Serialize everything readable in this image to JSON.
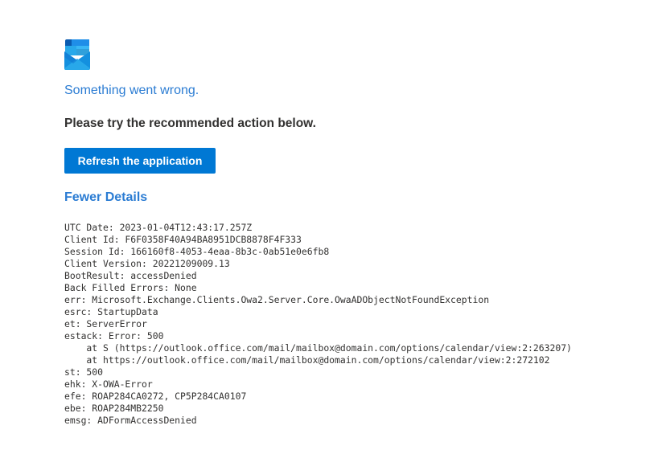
{
  "error_page": {
    "app_icon": "outlook-mail-icon",
    "title": "Something went wrong.",
    "subtitle": "Please try the recommended action below.",
    "action_button_label": "Refresh the application",
    "details_toggle_label": "Fewer Details",
    "details_lines": [
      "UTC Date: 2023-01-04T12:43:17.257Z",
      "Client Id: F6F0358F40A94BA8951DCB8878F4F333",
      "Session Id: 166160f8-4053-4eaa-8b3c-0ab51e0e6fb8",
      "Client Version: 20221209009.13",
      "BootResult: accessDenied",
      "Back Filled Errors: None",
      "err: Microsoft.Exchange.Clients.Owa2.Server.Core.OwaADObjectNotFoundException",
      "esrc: StartupData",
      "et: ServerError",
      "estack: Error: 500",
      "    at S (https://outlook.office.com/mail/mailbox@domain.com/options/calendar/view:2:263207)",
      "    at https://outlook.office.com/mail/mailbox@domain.com/options/calendar/view:2:272102",
      "st: 500",
      "ehk: X-OWA-Error",
      "efe: ROAP284CA0272, CP5P284CA0107",
      "ebe: ROAP284MB2250",
      "emsg: ADFormAccessDenied"
    ]
  },
  "colors": {
    "accent": "#0078d4",
    "link": "#2b7cd3",
    "text": "#323130",
    "background": "#ffffff"
  }
}
